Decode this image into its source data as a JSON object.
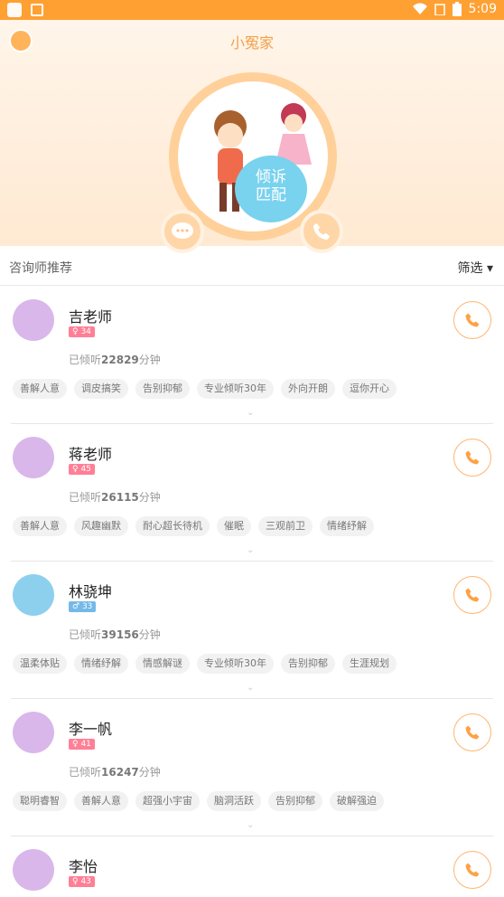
{
  "status": {
    "time": "5:09"
  },
  "header": {
    "title": "小冤家"
  },
  "hero": {
    "match_line1": "倾诉",
    "match_line2": "匹配"
  },
  "filterbar": {
    "title": "咨询师推荐",
    "filter_label": "筛选 ▾"
  },
  "counselors": [
    {
      "name": "吉老师",
      "gender": "female",
      "age": "34",
      "badge_color": "#ff7f96",
      "avatar_color": "#d9b7ea",
      "listen_prefix": "已倾听",
      "minutes": "22829",
      "listen_suffix": "分钟",
      "tags": [
        "善解人意",
        "调皮搞笑",
        "告别抑郁",
        "专业倾听30年",
        "外向开朗",
        "逗你开心"
      ]
    },
    {
      "name": "蒋老师",
      "gender": "female",
      "age": "45",
      "badge_color": "#ff7f96",
      "avatar_color": "#d9b7ea",
      "listen_prefix": "已倾听",
      "minutes": "26115",
      "listen_suffix": "分钟",
      "tags": [
        "善解人意",
        "风趣幽默",
        "耐心超长待机",
        "催眠",
        "三观前卫",
        "情绪纾解"
      ]
    },
    {
      "name": "林骁坤",
      "gender": "male",
      "age": "33",
      "badge_color": "#74b9e8",
      "avatar_color": "#8dd0ee",
      "listen_prefix": "已倾听",
      "minutes": "39156",
      "listen_suffix": "分钟",
      "tags": [
        "温柔体贴",
        "情绪纾解",
        "情感解谜",
        "专业倾听30年",
        "告别抑郁",
        "生涯规划"
      ]
    },
    {
      "name": "李一帆",
      "gender": "female",
      "age": "41",
      "badge_color": "#ff7f96",
      "avatar_color": "#d9b7ea",
      "listen_prefix": "已倾听",
      "minutes": "16247",
      "listen_suffix": "分钟",
      "tags": [
        "聪明睿智",
        "善解人意",
        "超强小宇宙",
        "脑洞活跃",
        "告别抑郁",
        "破解强迫"
      ]
    },
    {
      "name": "李怡",
      "gender": "female",
      "age": "43",
      "badge_color": "#ff7f96",
      "avatar_color": "#d9b7ea",
      "listen_prefix": "",
      "minutes": "",
      "listen_suffix": "",
      "tags": []
    }
  ]
}
